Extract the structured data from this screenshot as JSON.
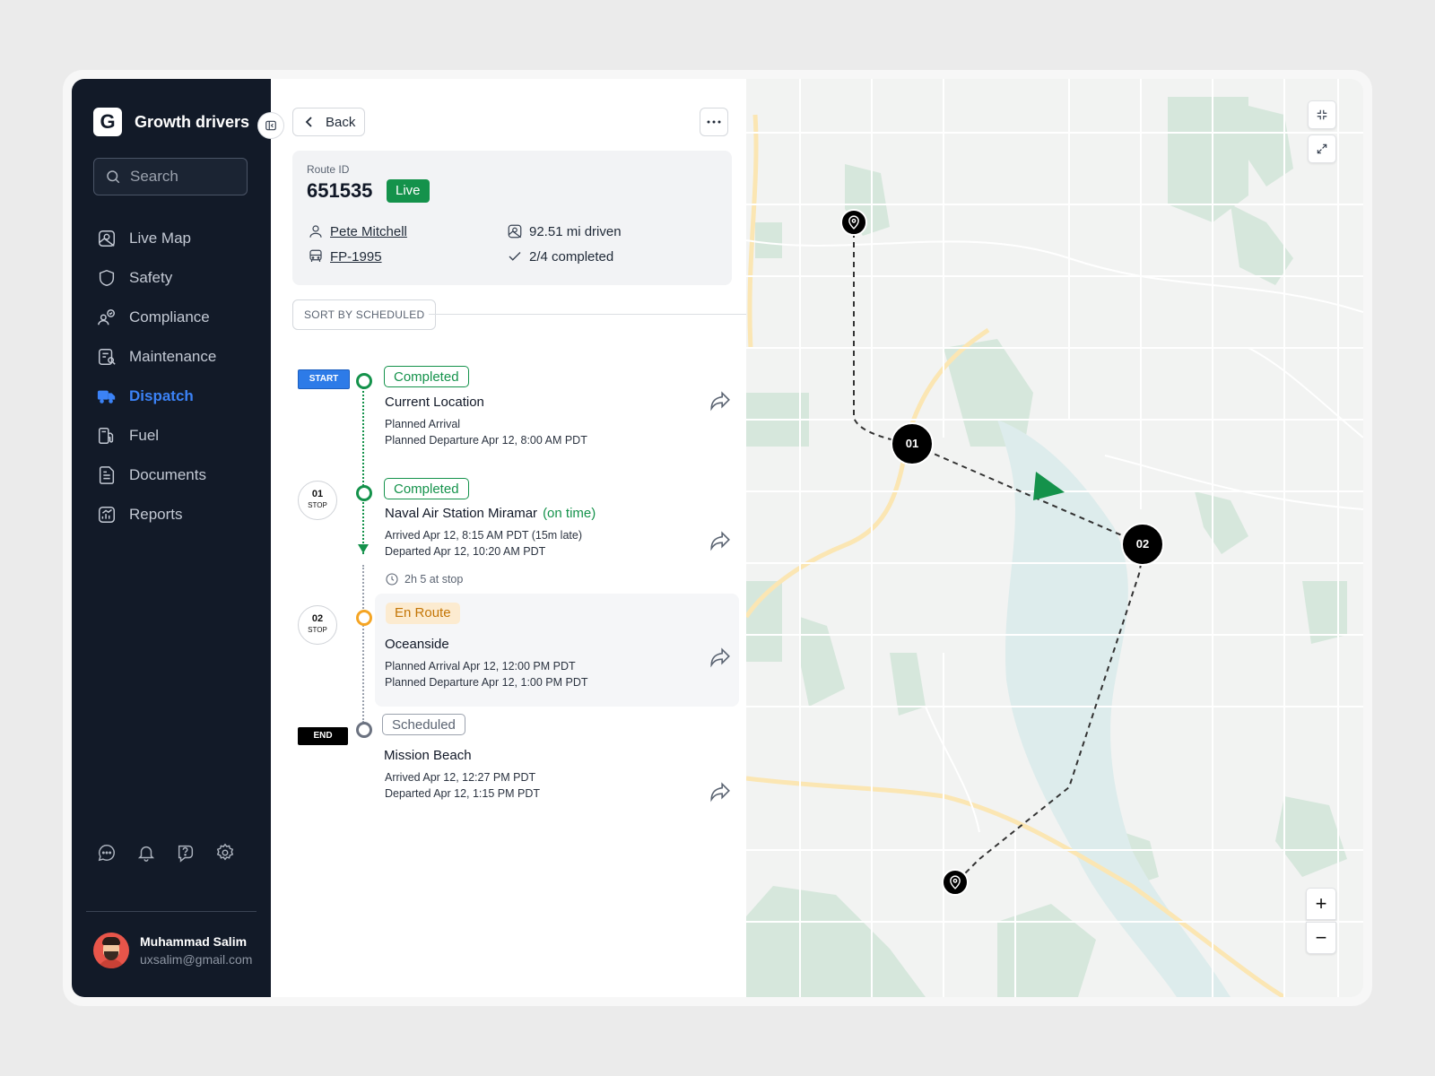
{
  "app": {
    "brand": "Growth drivers",
    "logo_letter": "G"
  },
  "search": {
    "placeholder": "Search"
  },
  "nav": [
    {
      "label": "Live Map",
      "icon": "map-icon"
    },
    {
      "label": "Safety",
      "icon": "shield-icon"
    },
    {
      "label": "Compliance",
      "icon": "compliance-icon"
    },
    {
      "label": "Maintenance",
      "icon": "maintenance-icon"
    },
    {
      "label": "Dispatch",
      "icon": "truck-icon",
      "active": true
    },
    {
      "label": "Fuel",
      "icon": "fuel-icon"
    },
    {
      "label": "Documents",
      "icon": "document-icon"
    },
    {
      "label": "Reports",
      "icon": "report-icon"
    }
  ],
  "bottom_icons": [
    "chat-icon",
    "bell-icon",
    "help-icon",
    "gear-icon"
  ],
  "user": {
    "name": "Muhammad Salim",
    "email": "uxsalim@gmail.com"
  },
  "header": {
    "back_label": "Back"
  },
  "route": {
    "label": "Route ID",
    "id": "651535",
    "status": "Live",
    "driver": "Pete Mitchell",
    "vehicle": "FP-1995",
    "distance": "92.51 mi driven",
    "progress": "2/4 completed"
  },
  "sort_label": "SORT BY SCHEDULED",
  "stops": [
    {
      "tag": "START",
      "status": "Completed",
      "title": "Current Location",
      "note": "",
      "line1": "Planned Arrival",
      "line2": "Planned Departure Apr 12, 8:00 AM PDT"
    },
    {
      "number": "01",
      "number_label": "STOP",
      "status": "Completed",
      "title": "Naval Air Station Miramar",
      "note": "(on time)",
      "line1": "Arrived Apr 12, 8:15 AM PDT (15m late)",
      "line2": "Departed Apr 12, 10:20 AM PDT",
      "duration": "2h 5 at stop"
    },
    {
      "number": "02",
      "number_label": "STOP",
      "status": "En Route",
      "title": "Oceanside",
      "note": "",
      "line1": "Planned Arrival Apr 12, 12:00 PM PDT",
      "line2": "Planned Departure Apr 12, 1:00 PM PDT"
    },
    {
      "tag": "END",
      "status": "Scheduled",
      "title": "Mission Beach",
      "note": "",
      "line1": "Arrived Apr 12, 12:27 PM PDT",
      "line2": "Departed Apr 12, 1:15 PM PDT"
    }
  ],
  "map": {
    "markers": [
      "01",
      "02"
    ],
    "zoom_in": "+",
    "zoom_out": "−",
    "colors": {
      "water": "#ddecec",
      "park": "#d6e7dc",
      "highway": "#fbe6b3",
      "vehicle": "#14924b"
    }
  }
}
